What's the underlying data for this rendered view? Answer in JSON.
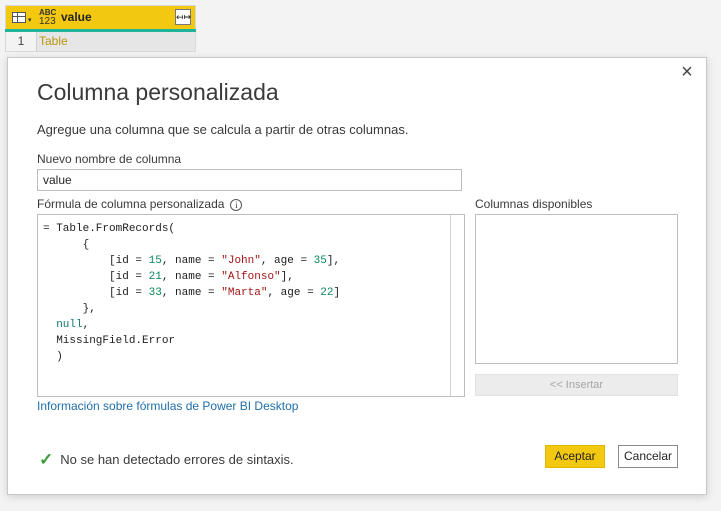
{
  "grid": {
    "type_icon_top": "ABC",
    "type_icon_bottom": "123",
    "column_name": "value",
    "expand_icon": "expand-columns-icon",
    "rows": [
      {
        "num": "1",
        "value": "Table"
      }
    ]
  },
  "dialog": {
    "title": "Columna personalizada",
    "subtitle": "Agregue una columna que se calcula a partir de otras columnas.",
    "name_label": "Nuevo nombre de columna",
    "name_value": "value",
    "formula_label": "Fórmula de columna personalizada",
    "info_icon": "i",
    "formula_lines": [
      "= Table.FromRecords(",
      "      {",
      "          [id = 15, name = \"John\", age = 35],",
      "          [id = 21, name = \"Alfonso\"],",
      "          [id = 33, name = \"Marta\", age = 22]",
      "      },",
      "  null,",
      "  MissingField.Error",
      "  )"
    ],
    "available_columns_label": "Columnas disponibles",
    "insert_label": "<< Insertar",
    "help_link": "Información sobre fórmulas de Power BI Desktop",
    "status_text": "No se han detectado errores de sintaxis.",
    "ok_label": "Aceptar",
    "cancel_label": "Cancelar",
    "close_glyph": "×"
  },
  "colors": {
    "accent": "#f2c811",
    "teal": "#1fb39a",
    "link": "#1f6ea9",
    "success": "#3c9b3c"
  }
}
